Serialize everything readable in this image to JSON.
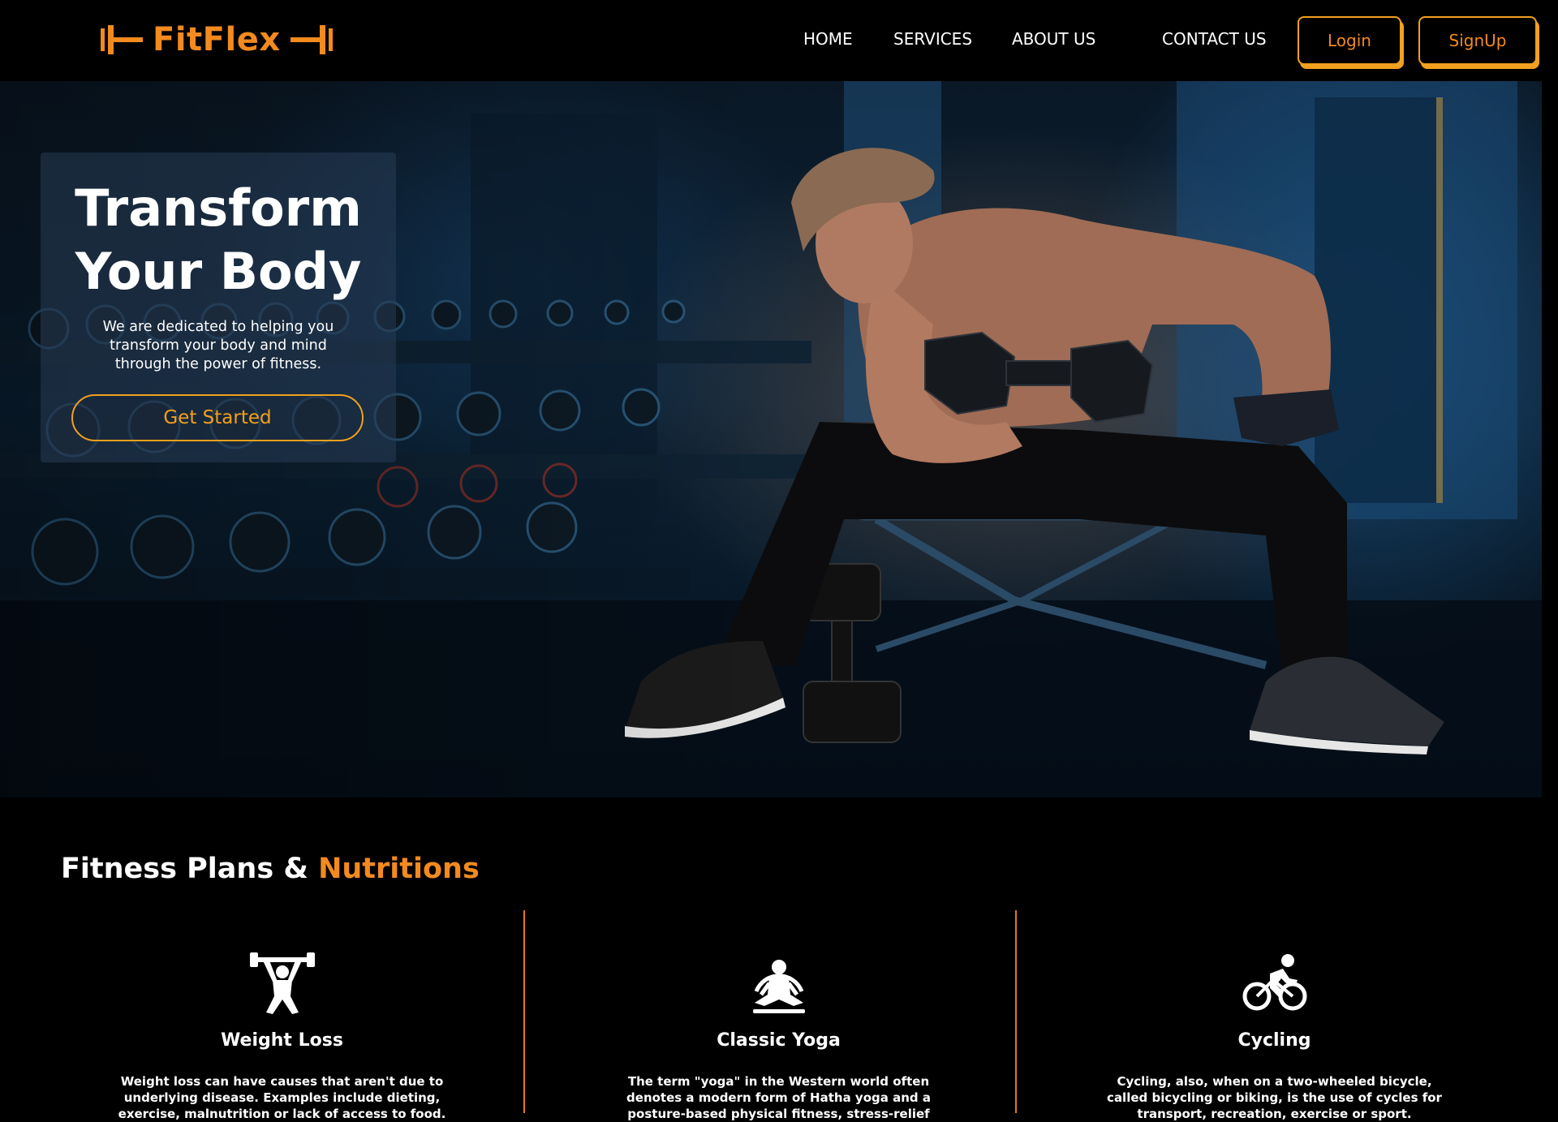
{
  "nav": {
    "brand": "FitFlex",
    "links": [
      "HOME",
      "SERVICES",
      "ABOUT US",
      "CONTACT US"
    ],
    "login_label": "Login",
    "signup_label": "SignUp"
  },
  "hero": {
    "title_line1": "Transform",
    "title_line2": "Your Body",
    "subtitle": "We are dedicated to helping you transform your body and mind through the power of fitness.",
    "cta_label": "Get Started"
  },
  "section": {
    "title_main": "Fitness Plans & ",
    "title_accent": "Nutritions"
  },
  "plans": [
    {
      "icon": "weightlifting-icon",
      "title": "Weight Loss",
      "description": "Weight loss can have causes that aren't due to underlying disease. Examples include dieting, exercise, malnutrition or lack of access to food."
    },
    {
      "icon": "yoga-icon",
      "title": "Classic Yoga",
      "description": "The term \"yoga\" in the Western world often denotes a modern form of Hatha yoga and a posture-based physical fitness, stress-relief"
    },
    {
      "icon": "cycling-icon",
      "title": "Cycling",
      "description": "Cycling, also, when on a two-wheeled bicycle, called bicycling or biking, is the use of cycles for transport, recreation, exercise or sport."
    }
  ],
  "colors": {
    "accent": "#f28a1e",
    "button_border": "#f2a01e",
    "background": "#000000"
  }
}
